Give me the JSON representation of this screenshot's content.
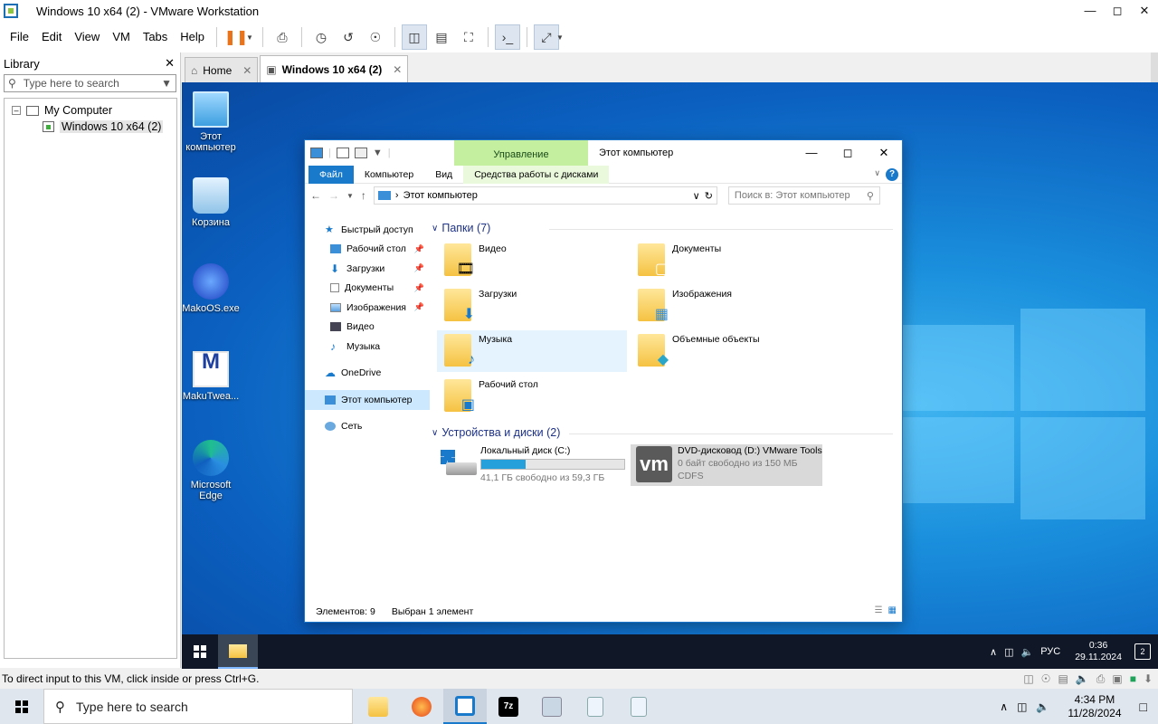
{
  "window": {
    "title": "Windows 10 x64 (2) - VMware Workstation"
  },
  "menu": [
    "File",
    "Edit",
    "View",
    "VM",
    "Tabs",
    "Help"
  ],
  "library": {
    "title": "Library",
    "search_placeholder": "Type here to search",
    "tree": {
      "root": "My Computer",
      "child": "Windows 10 x64 (2)"
    }
  },
  "tabs": {
    "home": "Home",
    "vm": "Windows 10 x64 (2)"
  },
  "desktop_icons": [
    "Этот компьютер",
    "Корзина",
    "MakoOS.exe",
    "MakuTwea...",
    "Microsoft Edge"
  ],
  "explorer": {
    "manage_tab": "Управление",
    "title": "Этот компьютер",
    "ribbon": {
      "file": "Файл",
      "computer": "Компьютер",
      "view": "Вид",
      "disk_tools": "Средства работы с дисками"
    },
    "address": "Этот компьютер",
    "search_placeholder": "Поиск в: Этот компьютер",
    "nav": {
      "quick_access": "Быстрый доступ",
      "desktop": "Рабочий стол",
      "downloads": "Загрузки",
      "documents": "Документы",
      "pictures": "Изображения",
      "videos": "Видео",
      "music": "Музыка",
      "onedrive": "OneDrive",
      "this_pc": "Этот компьютер",
      "network": "Сеть"
    },
    "folders_header": "Папки (7)",
    "folders": {
      "video": "Видео",
      "documents": "Документы",
      "downloads": "Загрузки",
      "pictures": "Изображения",
      "music": "Музыка",
      "objects3d": "Объемные объекты",
      "desktop": "Рабочий стол"
    },
    "devices_header": "Устройства и диски (2)",
    "drives": {
      "c": {
        "name": "Локальный диск (C:)",
        "free": "41,1 ГБ свободно из 59,3 ГБ",
        "used_fraction": 0.307
      },
      "d": {
        "name": "DVD-дисковод (D:) VMware Tools",
        "free": "0 байт свободно из 150 МБ",
        "fs": "CDFS"
      }
    },
    "status": {
      "items": "Элементов: 9",
      "selected": "Выбран 1 элемент"
    }
  },
  "guest_taskbar": {
    "lang": "РУС",
    "time": "0:36",
    "date": "29.11.2024",
    "notifications": "2"
  },
  "vm_status": "To direct input to this VM, click inside or press Ctrl+G.",
  "host_taskbar": {
    "search": "Type here to search",
    "time": "4:34 PM",
    "date": "11/28/2024"
  },
  "colors": {
    "accent": "#1979ca",
    "manage_green": "#c4ef9e",
    "pause_orange": "#e8731a"
  }
}
